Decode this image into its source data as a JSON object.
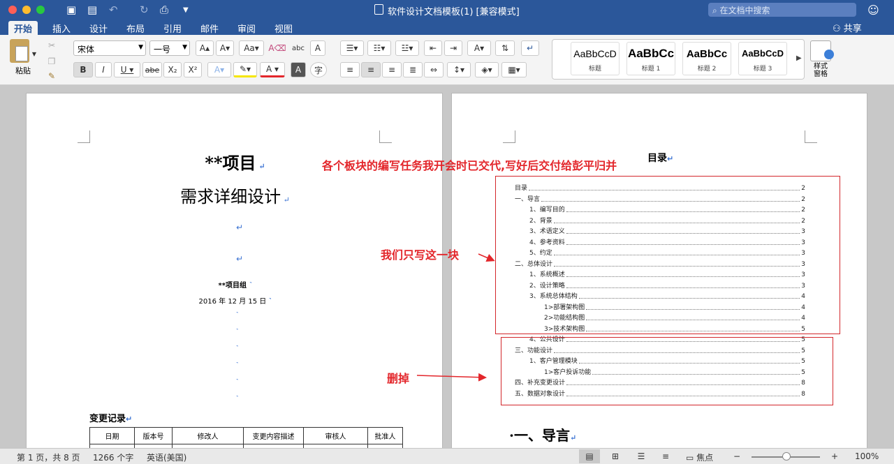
{
  "window": {
    "title": "软件设计文档模板(1) [兼容模式]",
    "search_placeholder": "在文档中搜索"
  },
  "tabs": [
    "开始",
    "插入",
    "设计",
    "布局",
    "引用",
    "邮件",
    "审阅",
    "视图"
  ],
  "share_label": "共享",
  "ribbon": {
    "paste_label": "粘贴",
    "font_name": "宋体",
    "font_size": "一号",
    "styles": [
      {
        "sample": "AaBbCcD",
        "name": "标题"
      },
      {
        "sample": "AaBbCc",
        "name": "标题 1"
      },
      {
        "sample": "AaBbCc",
        "name": "标题 2"
      },
      {
        "sample": "AaBbCcD",
        "name": "标题 3"
      }
    ],
    "styles_pane_label_1": "样式",
    "styles_pane_label_2": "窗格"
  },
  "page_left": {
    "title_project": "**项目",
    "title_req": "需求详细设计",
    "group": "**项目组",
    "date": "2016 年 12 月 15 日",
    "change_heading": "变更记录",
    "change_columns": [
      "日期",
      "版本号",
      "修改人",
      "变更内容描述",
      "审核人",
      "批准人"
    ]
  },
  "page_right": {
    "toc_title": "目录",
    "toc": [
      {
        "text": "目录",
        "page": "2",
        "level": 0
      },
      {
        "text": "一、导言",
        "page": "2",
        "level": 0
      },
      {
        "text": "1、编写目的",
        "page": "2",
        "level": 1
      },
      {
        "text": "2、背景",
        "page": "2",
        "level": 1
      },
      {
        "text": "3、术语定义",
        "page": "3",
        "level": 1
      },
      {
        "text": "4、参考资料",
        "page": "3",
        "level": 1
      },
      {
        "text": "5、约定",
        "page": "3",
        "level": 1
      },
      {
        "text": "二、总体设计",
        "page": "3",
        "level": 0
      },
      {
        "text": "1、系统概述",
        "page": "3",
        "level": 1
      },
      {
        "text": "2、设计策略",
        "page": "3",
        "level": 1
      },
      {
        "text": "3、系统总体结构",
        "page": "4",
        "level": 1
      },
      {
        "text": "1>部署架构图",
        "page": "4",
        "level": 2
      },
      {
        "text": "2>功能结构图",
        "page": "4",
        "level": 2
      },
      {
        "text": "3>技术架构图",
        "page": "5",
        "level": 2
      },
      {
        "text": "4、公共设计",
        "page": "5",
        "level": 1
      },
      {
        "text": "三、功能设计",
        "page": "5",
        "level": 0
      },
      {
        "text": "1、客户管理模块",
        "page": "5",
        "level": 1
      },
      {
        "text": "1>客户投诉功能",
        "page": "5",
        "level": 2
      },
      {
        "text": "四、补充变更设计",
        "page": "8",
        "level": 0
      },
      {
        "text": "五、数据对象设计",
        "page": "8",
        "level": 0
      }
    ],
    "heading1": "一、导言"
  },
  "annotations": {
    "top_note": "各个板块的编写任务我开会时已交代,写好后交付给彭平归并",
    "write_note": "我们只写这一块",
    "delete_note": "删掉"
  },
  "status": {
    "pages": "第 1 页，共 8 页",
    "words": "1266 个字",
    "lang": "英语(美国)",
    "focus": "焦点",
    "zoom": "100%"
  },
  "colors": {
    "brand": "#2b579a",
    "annotation": "#e3262b",
    "paragraph_mark": "#3b73d3"
  }
}
